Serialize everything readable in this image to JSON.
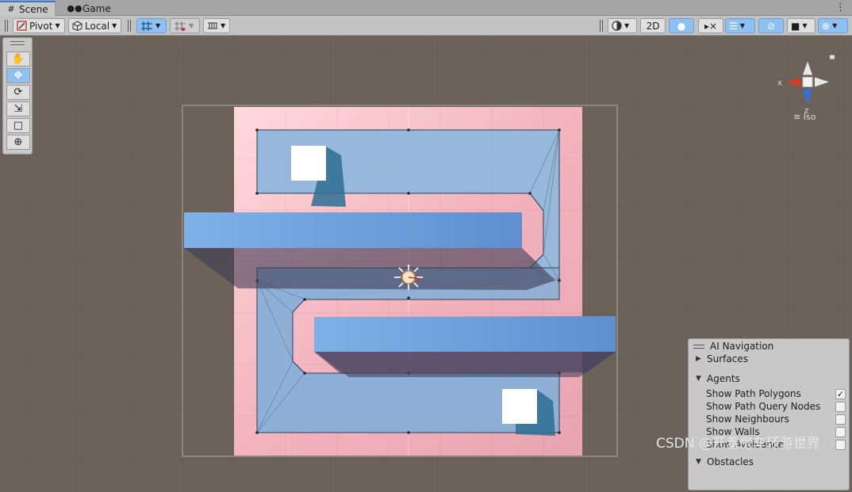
{
  "tabs": [
    {
      "label": "Scene",
      "icon": "hash-grid-icon",
      "active": true
    },
    {
      "label": "Game",
      "icon": "gamepad-icon",
      "active": false
    }
  ],
  "toolbar": {
    "pivot_label": "Pivot",
    "local_label": "Local",
    "two_d_label": "2D"
  },
  "tools": [
    "hand-tool",
    "move-tool",
    "rotate-tool",
    "scale-tool",
    "rect-tool",
    "transform-tool"
  ],
  "orientation": {
    "x_label": "x",
    "z_label": "z",
    "projection_label": "Iso"
  },
  "ai_navigation": {
    "title": "AI Navigation",
    "surfaces_label": "Surfaces",
    "agents_label": "Agents",
    "obstacles_label": "Obstacles",
    "options": [
      {
        "label": "Show Path Polygons",
        "checked": true
      },
      {
        "label": "Show Path Query Nodes",
        "checked": false
      },
      {
        "label": "Show Neighbours",
        "checked": false
      },
      {
        "label": "Show Walls",
        "checked": false
      },
      {
        "label": "Show Avoidance",
        "checked": false
      }
    ]
  },
  "watermark": "CSDN @开着房车环游世界",
  "colors": {
    "accent": "#3a79d8",
    "selected_tool": "#8ec1f1",
    "navmesh": "#8fb6dc",
    "floor": "#f2b3bd",
    "wall": "#6f9fd8"
  }
}
